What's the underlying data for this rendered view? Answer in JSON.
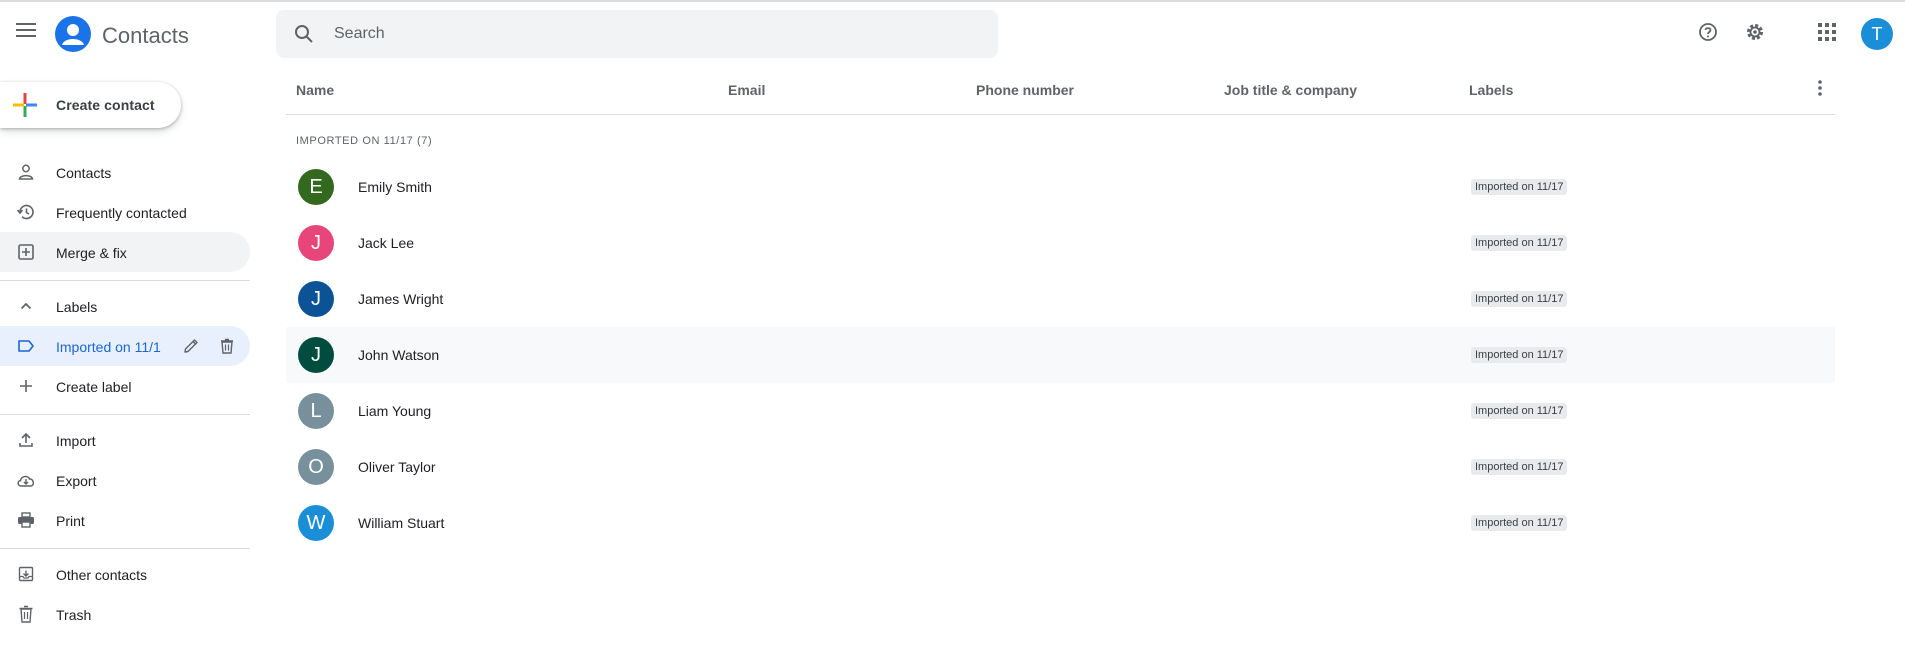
{
  "header": {
    "app_title": "Contacts",
    "search_placeholder": "Search",
    "account_initial": "T"
  },
  "sidebar": {
    "create_label": "Create contact",
    "items": [
      {
        "label": "Contacts",
        "icon": "person-icon"
      },
      {
        "label": "Frequently contacted",
        "icon": "history-icon"
      },
      {
        "label": "Merge & fix",
        "icon": "merge-fix-icon"
      },
      {
        "label": "Labels",
        "icon": "chevron-up-icon"
      },
      {
        "label": "Imported on 11/1",
        "icon": "label-icon"
      },
      {
        "label": "Create label",
        "icon": "plus-icon"
      },
      {
        "label": "Import",
        "icon": "upload-icon"
      },
      {
        "label": "Export",
        "icon": "cloud-download-icon"
      },
      {
        "label": "Print",
        "icon": "print-icon"
      },
      {
        "label": "Other contacts",
        "icon": "archive-icon"
      },
      {
        "label": "Trash",
        "icon": "trash-icon"
      }
    ]
  },
  "table": {
    "columns": [
      "Name",
      "Email",
      "Phone number",
      "Job title & company",
      "Labels"
    ],
    "group_heading": "IMPORTED ON 11/17 (7)",
    "rows": [
      {
        "initial": "E",
        "name": "Emily Smith",
        "label": "Imported on 11/17",
        "color": "#33691e"
      },
      {
        "initial": "J",
        "name": "Jack Lee",
        "label": "Imported on 11/17",
        "color": "#e8457a"
      },
      {
        "initial": "J",
        "name": "James Wright",
        "label": "Imported on 11/17",
        "color": "#0b5394"
      },
      {
        "initial": "J",
        "name": "John Watson",
        "label": "Imported on 11/17",
        "color": "#004d40"
      },
      {
        "initial": "L",
        "name": "Liam Young",
        "label": "Imported on 11/17",
        "color": "#78909c"
      },
      {
        "initial": "O",
        "name": "Oliver Taylor",
        "label": "Imported on 11/17",
        "color": "#78909c"
      },
      {
        "initial": "W",
        "name": "William Stuart",
        "label": "Imported on 11/17",
        "color": "#1a8fd8"
      }
    ]
  },
  "colors": {
    "accent": "#1a73e8",
    "active_bg": "#e8f0fe",
    "active_text": "#1967d2"
  }
}
